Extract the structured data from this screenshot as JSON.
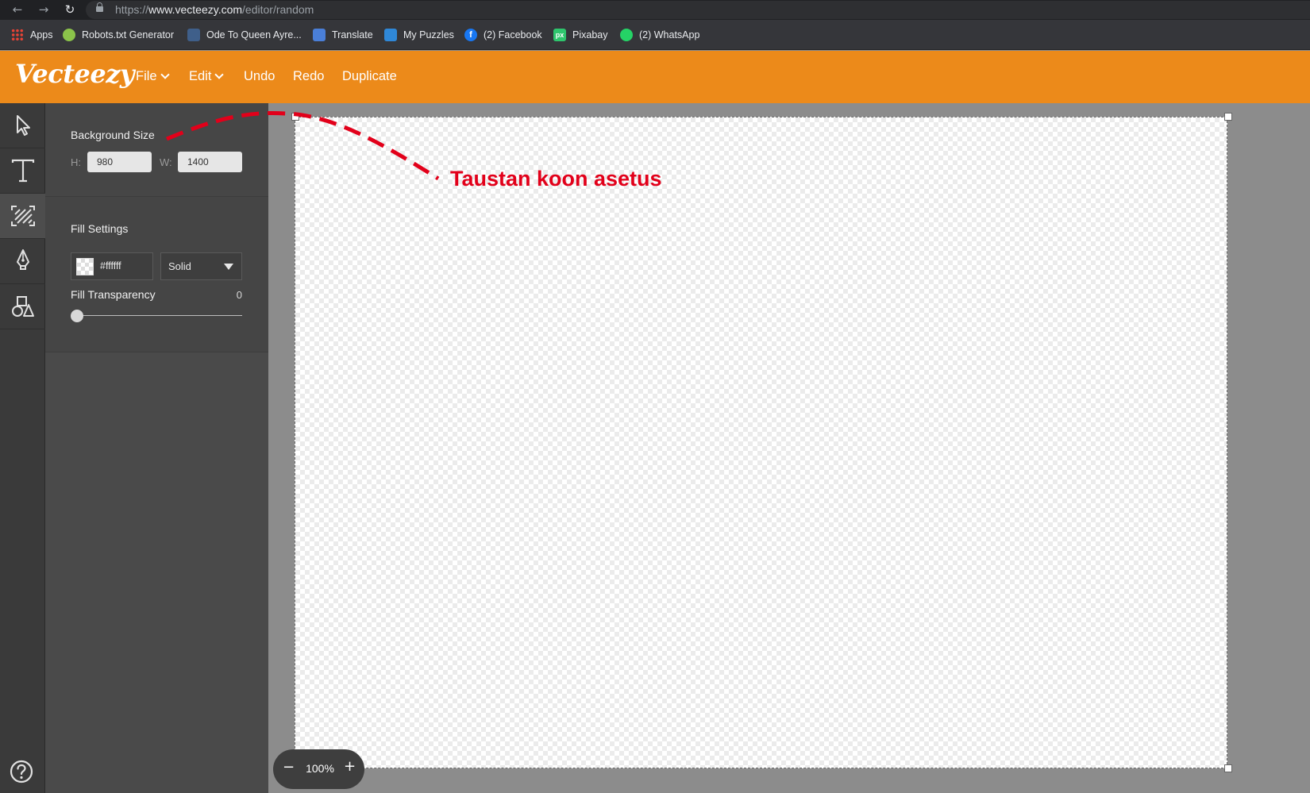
{
  "browser": {
    "url_scheme": "https://",
    "url_host": "www.vecteezy.com",
    "url_path": "/editor/random",
    "bookmarks": [
      {
        "label": "Apps",
        "icon": "apps-grid-icon"
      },
      {
        "label": "Robots.txt Generator",
        "icon": "robots-icon"
      },
      {
        "label": "Ode To Queen Ayre...",
        "icon": "ode-icon"
      },
      {
        "label": "Translate",
        "icon": "translate-icon"
      },
      {
        "label": "My Puzzles",
        "icon": "puzzle-icon"
      },
      {
        "label": "(2) Facebook",
        "icon": "facebook-icon"
      },
      {
        "label": "Pixabay",
        "icon": "pixabay-icon"
      },
      {
        "label": "(2) WhatsApp",
        "icon": "whatsapp-icon"
      }
    ]
  },
  "app": {
    "logo": "Vecteezy",
    "accent_color": "#ec8a1a",
    "menu": {
      "file": "File",
      "edit": "Edit",
      "undo": "Undo",
      "redo": "Redo",
      "duplicate": "Duplicate"
    }
  },
  "tools": [
    "select-tool",
    "text-tool",
    "background-tool",
    "pen-tool",
    "shapes-tool"
  ],
  "panel": {
    "background_size_title": "Background Size",
    "h_label": "H:",
    "h_value": "980",
    "w_label": "W:",
    "w_value": "1400",
    "fill_settings_title": "Fill Settings",
    "fill_color": "#ffffff",
    "fill_type": "Solid",
    "fill_transparency_title": "Fill Transparency",
    "fill_transparency_value": "0",
    "fill_transparency": 0
  },
  "canvas": {
    "zoom": "100%"
  },
  "annotation": {
    "text": "Taustan koon asetus",
    "color": "#e2001a"
  }
}
